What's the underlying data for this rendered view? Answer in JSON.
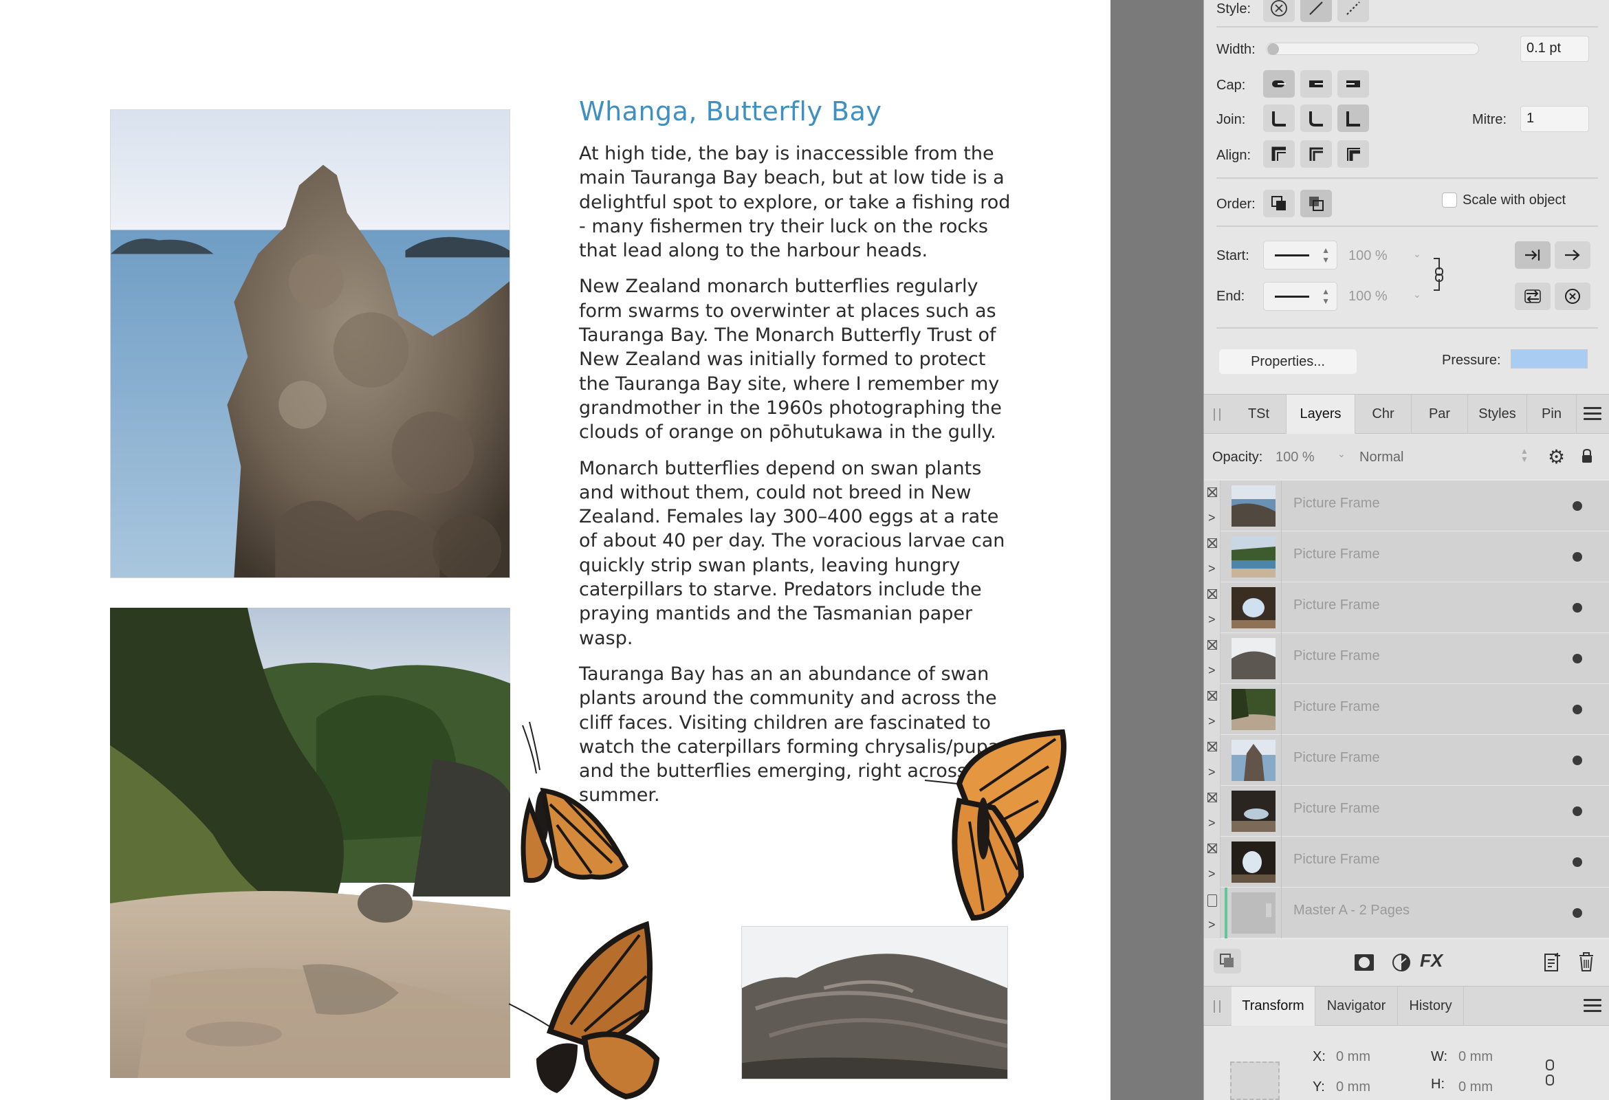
{
  "article": {
    "title": "Whanga, Butterfly Bay",
    "paragraphs": [
      "At high tide, the bay is inaccessible from the main Tauranga Bay beach, but at low tide is a delightful spot to explore, or take a fishing rod - many fishermen try their luck on the rocks that lead along to the harbour heads.",
      "New Zealand monarch butterflies regularly form swarms to overwinter at places such as Tauranga Bay. The Monarch Butterfly Trust of New Zealand was initially formed to protect the Tauranga Bay site, where I remember my grandmother in the 1960s photographing the clouds of orange on pōhutukawa in the gully.",
      "Monarch butterflies depend on swan plants and without them, could not breed in New Zealand. Females lay 300–400 eggs  at a rate of about 40 per day. The voracious larvae can quickly strip swan plants, leaving hungry caterpillars to starve. Predators include the praying mantids and the Tasmanian paper wasp.",
      "Tauranga Bay has an an abundance of swan plants around the community and across the cliff faces. Visiting children are fascinated to watch the caterpillars forming chrysalis/pupa and the butterflies emerging, right across the summer."
    ]
  },
  "stroke": {
    "style_label": "Style:",
    "width_label": "Width:",
    "width_value": "0.1 pt",
    "width_level": 0,
    "cap_label": "Cap:",
    "join_label": "Join:",
    "mitre_label": "Mitre:",
    "mitre_value": "1",
    "align_label": "Align:",
    "order_label": "Order:",
    "scale_label": "Scale with object",
    "start_label": "Start:",
    "start_pct": "100 %",
    "end_label": "End:",
    "end_pct": "100 %",
    "properties_label": "Properties...",
    "pressure_label": "Pressure:"
  },
  "tabs": [
    "TSt",
    "Layers",
    "Chr",
    "Par",
    "Styles",
    "Pin"
  ],
  "active_tab": "Layers",
  "layers_panel": {
    "opacity_label": "Opacity:",
    "opacity_value": "100 %",
    "blend_mode": "Normal",
    "items": [
      {
        "name": "Picture Frame",
        "thumb": "rock-sea"
      },
      {
        "name": "Picture Frame",
        "thumb": "bay"
      },
      {
        "name": "Picture Frame",
        "thumb": "arch"
      },
      {
        "name": "Picture Frame",
        "thumb": "stone"
      },
      {
        "name": "Picture Frame",
        "thumb": "creek"
      },
      {
        "name": "Picture Frame",
        "thumb": "tower"
      },
      {
        "name": "Picture Frame",
        "thumb": "cave"
      },
      {
        "name": "Picture Frame",
        "thumb": "arch2"
      },
      {
        "name": "Master A - 2 Pages",
        "thumb": "master"
      }
    ]
  },
  "bottom_tabs": [
    "Transform",
    "Navigator",
    "History"
  ],
  "transform": {
    "x_label": "X:",
    "x_value": "0 mm",
    "y_label": "Y:",
    "y_value": "0 mm",
    "w_label": "W:",
    "w_value": "0 mm",
    "h_label": "H:",
    "h_value": "0 mm"
  },
  "colors": {
    "title_blue": "#3e8fc2",
    "panel_bg": "#e6e6e6",
    "pasteboard": "#7a7a7a",
    "pressure_swatch": "#a9cdf2"
  }
}
